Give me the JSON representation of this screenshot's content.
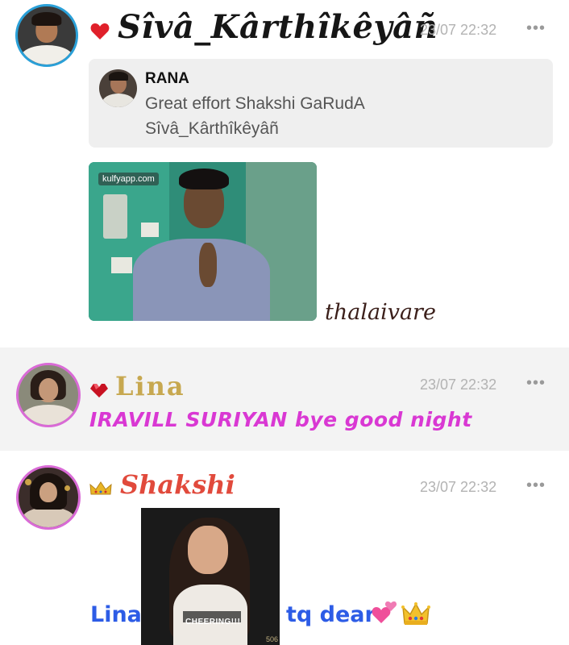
{
  "messages": [
    {
      "sender": "Sîvâ_Kârthîkêyâñ",
      "timestamp": "23/07 22:32",
      "more_label": "•••",
      "badge_icon": "heart-icon",
      "quote": {
        "author": "RANA",
        "text_line1": "Great effort Shakshi GaRudA",
        "text_line2": "Sîvâ_Kârthîkêyâñ"
      },
      "gif_watermark": "kulfyapp.com",
      "caption": "thalaivare"
    },
    {
      "sender": "Lina",
      "timestamp": "23/07 22:32",
      "more_label": "•••",
      "badge_icon": "ruby-heart-icon",
      "text": "IRAVILL SURIYAN bye good night"
    },
    {
      "sender": "Shakshi",
      "timestamp": "23/07 22:32",
      "more_label": "•••",
      "badge_icon": "crown-icon",
      "gif_caption": "CHEERING!!!",
      "gif_counter": "506",
      "text_left": "Lina",
      "text_right": "tq dear",
      "emojis": [
        "two-hearts-icon",
        "crown-icon"
      ]
    }
  ],
  "colors": {
    "accent_blue": "#2aa0d8",
    "accent_pink": "#d96ad6",
    "message_pink": "#d938d3",
    "message_blue": "#2d5ce6",
    "sender_red": "#e14a3c",
    "sender_gold": "#c7a850"
  }
}
